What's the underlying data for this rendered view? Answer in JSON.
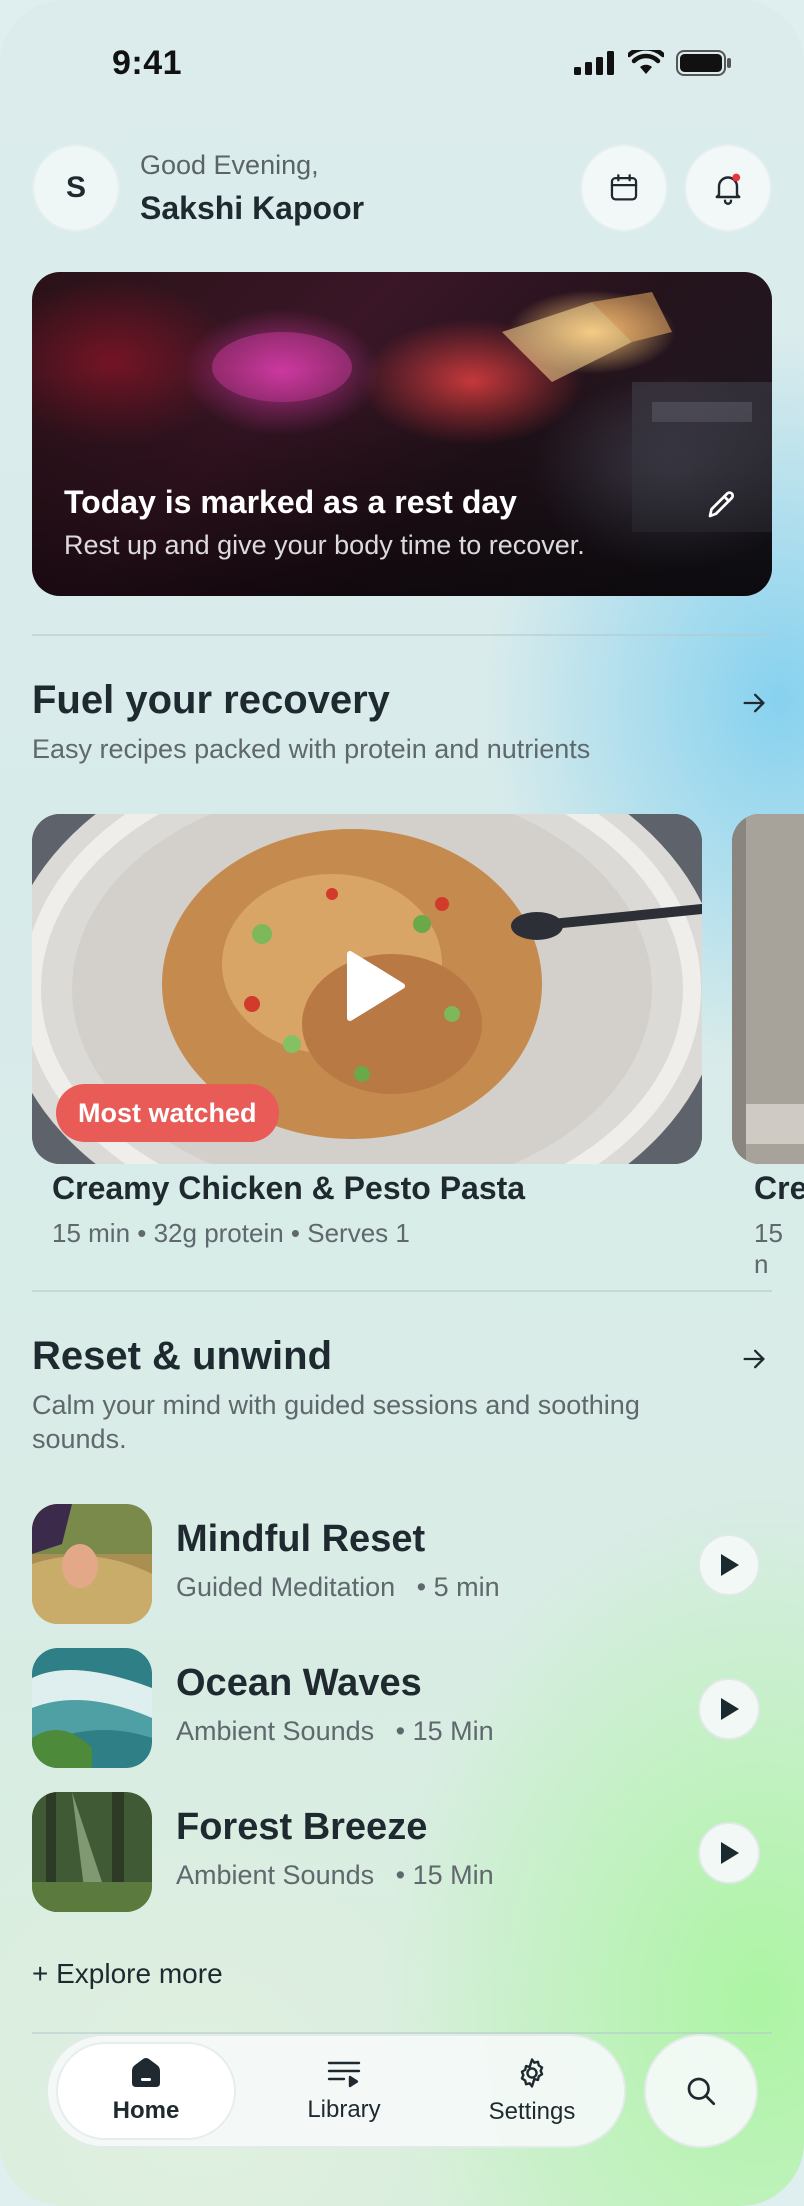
{
  "status_bar": {
    "time": "9:41"
  },
  "header": {
    "avatar_initial": "S",
    "greeting": "Good Evening,",
    "user_name": "Sakshi Kapoor"
  },
  "hero": {
    "title": "Today is marked as a rest day",
    "subtitle": "Rest up and give your body time to recover."
  },
  "recovery": {
    "title": "Fuel your recovery",
    "subtitle": "Easy recipes packed with protein and nutrients",
    "recipes": [
      {
        "badge": "Most watched",
        "name": "Creamy Chicken & Pesto Pasta",
        "meta": "15 min • 32g protein • Serves 1"
      },
      {
        "name": "Cre",
        "meta": "15 n"
      }
    ]
  },
  "unwind": {
    "title": "Reset & unwind",
    "subtitle": "Calm your mind with guided sessions and soothing sounds.",
    "sessions": [
      {
        "title": "Mindful Reset",
        "type": "Guided Meditation",
        "duration": "• 5 min"
      },
      {
        "title": "Ocean Waves",
        "type": "Ambient Sounds",
        "duration": "• 15 Min"
      },
      {
        "title": "Forest Breeze",
        "type": "Ambient Sounds",
        "duration": "• 15 Min"
      }
    ],
    "explore_label": "+ Explore more"
  },
  "nav": {
    "items": [
      {
        "label": "Home",
        "icon": "home-icon",
        "active": true
      },
      {
        "label": "Library",
        "icon": "library-icon",
        "active": false
      },
      {
        "label": "Settings",
        "icon": "gear-icon",
        "active": false
      }
    ],
    "search_icon": "search-icon"
  },
  "colors": {
    "badge": "#e85b57",
    "notification_dot": "#e8343a",
    "text_primary": "#1f2a30",
    "text_secondary": "#5f686c"
  }
}
